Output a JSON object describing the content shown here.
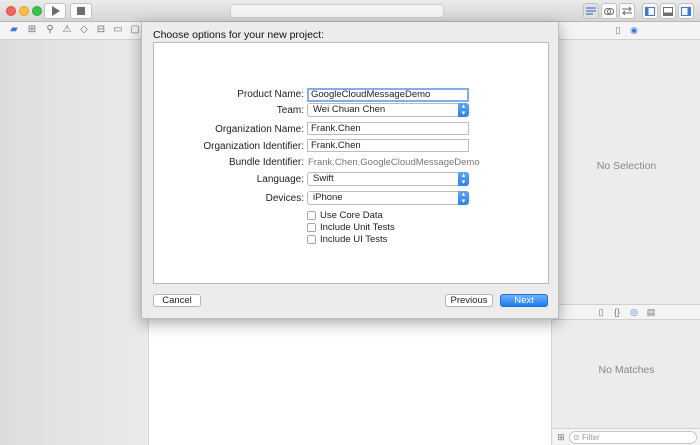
{
  "sheet": {
    "title": "Choose options for your new project:",
    "fields": {
      "product_name": {
        "label": "Product Name:",
        "value": "GoogleCloudMessageDemo"
      },
      "team": {
        "label": "Team:",
        "value": "Wei Chuan Chen"
      },
      "organization_name": {
        "label": "Organization Name:",
        "value": "Frank.Chen"
      },
      "organization_identifier": {
        "label": "Organization Identifier:",
        "value": "Frank.Chen"
      },
      "bundle_identifier": {
        "label": "Bundle Identifier:",
        "value": "Frank.Chen.GoogleCloudMessageDemo"
      },
      "language": {
        "label": "Language:",
        "value": "Swift"
      },
      "devices": {
        "label": "Devices:",
        "value": "iPhone"
      }
    },
    "checkboxes": [
      {
        "label": "Use Core Data",
        "checked": false
      },
      {
        "label": "Include Unit Tests",
        "checked": false
      },
      {
        "label": "Include UI Tests",
        "checked": false
      }
    ],
    "buttons": {
      "cancel": "Cancel",
      "previous": "Previous",
      "next": "Next"
    }
  },
  "inspector": {
    "empty_text": "No Selection"
  },
  "library": {
    "empty_text": "No Matches",
    "filter_placeholder": "Filter"
  },
  "colors": {
    "accent": "#1c7cf0",
    "focus_ring": "#82aef0"
  },
  "icons": {
    "toolbar": [
      "run-icon",
      "stop-icon",
      "standard-editor-icon",
      "assistant-editor-icon",
      "version-editor-icon",
      "navigator-toggle-icon",
      "debug-toggle-icon",
      "utilities-toggle-icon"
    ],
    "navigator": [
      "folder-icon",
      "symbol-icon",
      "search-icon",
      "warning-icon",
      "test-icon",
      "debug-icon",
      "breakpoint-icon",
      "report-icon"
    ],
    "inspector": [
      "file-inspector-icon",
      "quick-help-icon"
    ],
    "library": [
      "file-template-icon",
      "code-snippet-icon",
      "object-library-icon",
      "media-library-icon"
    ]
  }
}
